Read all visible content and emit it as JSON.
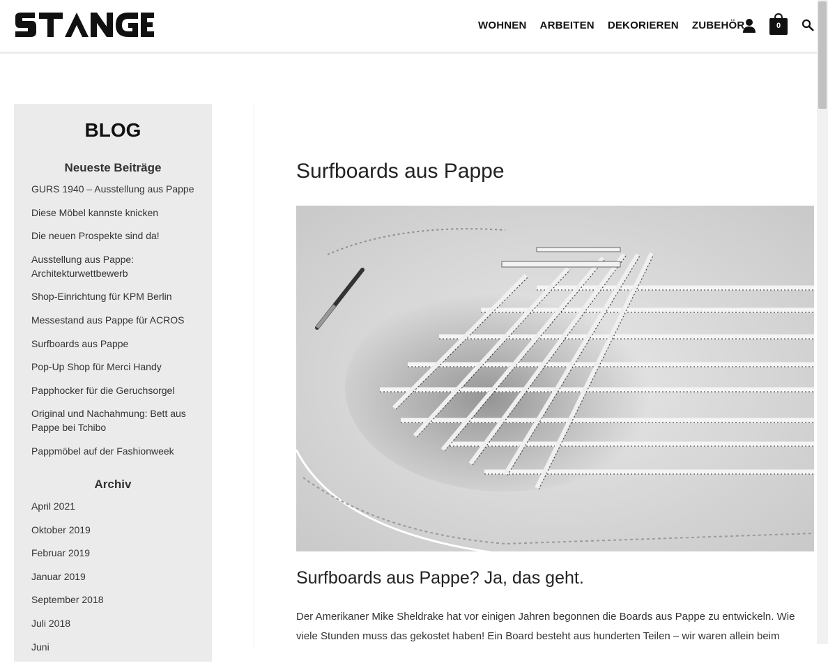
{
  "header": {
    "logo": "STANGE",
    "nav": [
      "WOHNEN",
      "ARBEITEN",
      "DEKORIEREN",
      "ZUBEHÖR"
    ],
    "cart_count": "0",
    "icons": [
      "user-icon",
      "cart-icon",
      "search-icon"
    ]
  },
  "sidebar": {
    "title": "BLOG",
    "recent_heading": "Neueste Beiträge",
    "recent": [
      "GURS 1940 – Ausstellung aus Pappe",
      "Diese Möbel kannste knicken",
      "Die neuen Prospekte sind da!",
      "Ausstellung aus Pappe: Architekturwettbewerb",
      "Shop-Einrichtung für KPM Berlin",
      "Messestand aus Pappe für ACROS",
      "Surfboards aus Pappe",
      "Pop-Up Shop für Merci Handy",
      "Papphocker für die Geruchsorgel",
      "Original und Nachahmung: Bett aus Pappe bei Tchibo",
      "Pappmöbel auf der Fashionweek"
    ],
    "archive_heading": "Archiv",
    "archive": [
      "April 2021",
      "Oktober 2019",
      "Februar 2019",
      "Januar 2019",
      "September 2018",
      "Juli 2018",
      "Juni"
    ]
  },
  "post": {
    "title": "Surfboards aus Pappe",
    "subtitle": "Surfboards aus Pappe? Ja, das geht.",
    "body": "Der Amerikaner Mike Sheldrake hat vor einigen Jahren begonnen die Boards aus Pappe zu entwickeln. Wie viele Stunden muss das gekostet haben! Ein Board besteht aus hunderten Teilen – wir waren allein beim"
  },
  "colors": {
    "sidebar_bg": "#ebebeb",
    "text": "#222222",
    "cart_bg": "#111111"
  }
}
